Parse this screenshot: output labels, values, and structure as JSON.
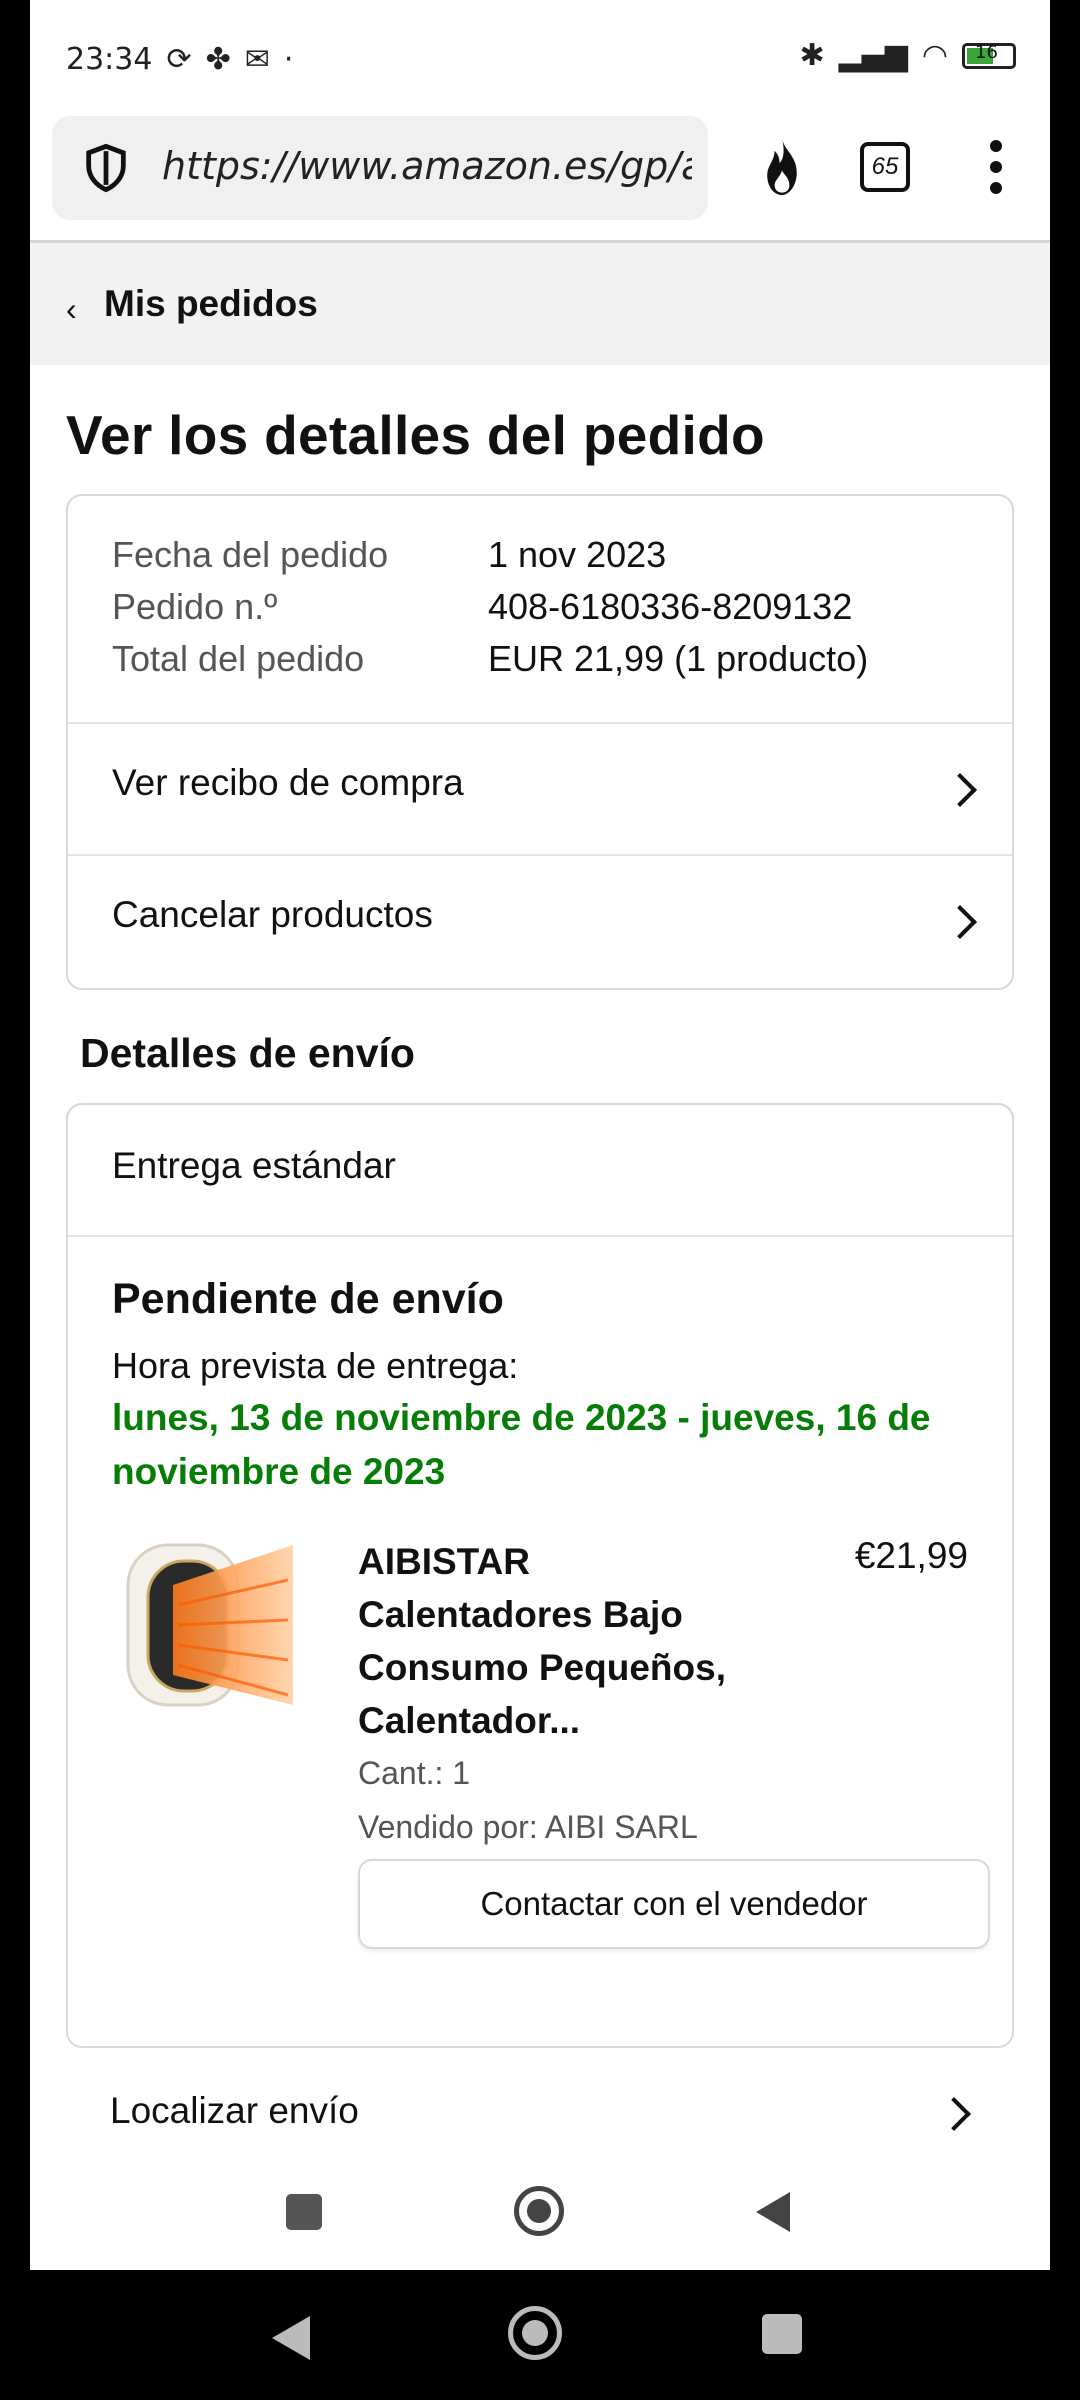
{
  "status_bar": {
    "time": "23:34",
    "battery": "16"
  },
  "browser": {
    "url": "https://www.amazon.es/gp/aw/y...",
    "tab_count": "65"
  },
  "breadcrumb": {
    "label": "Mis pedidos"
  },
  "page_title": "Ver los detalles del pedido",
  "order": {
    "date_label": "Fecha del pedido",
    "date_value": "1 nov 2023",
    "number_label": "Pedido n.º",
    "number_value": "408-6180336-8209132",
    "total_label": "Total del pedido",
    "total_value": "EUR 21,99 (1 producto)"
  },
  "actions": {
    "receipt": "Ver recibo de compra",
    "cancel": "Cancelar productos"
  },
  "shipping": {
    "section_title": "Detalles de envío",
    "type": "Entrega estándar",
    "status": "Pendiente de envío",
    "eta_label": "Hora prevista de entrega:",
    "eta_date": "lunes, 13 de noviembre de 2023 - jueves, 16 de noviembre de 2023"
  },
  "product": {
    "title": "AIBISTAR Calentadores Bajo Consumo Pequeños, Calentador...",
    "price": "€21,99",
    "quantity": "Cant.: 1",
    "seller": "Vendido por: AIBI SARL",
    "contact_label": "Contactar con el vendedor"
  },
  "track": {
    "label": "Localizar envío"
  },
  "colors": {
    "eta_green": "#067d06",
    "card_border": "#d5d9d9"
  }
}
